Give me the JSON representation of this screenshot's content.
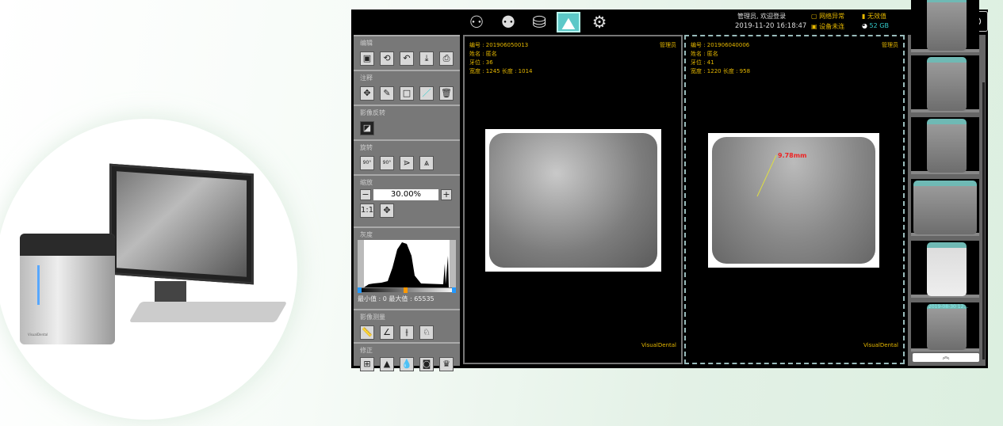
{
  "topbar": {
    "user": "管理员, 欢迎登录",
    "datetime": "2019-11-20 16:18:47",
    "network": "网络异常",
    "device": "设备未连",
    "value": "无效值",
    "disk": "52 GB"
  },
  "toolbar": {
    "nav_icons": [
      "add-patient-icon",
      "patients-icon",
      "database-search-icon",
      "image-icon",
      "settings-icon"
    ],
    "right_icons": [
      "network-settings-icon",
      "export-icon",
      "power-icon"
    ]
  },
  "left_panel": {
    "sections": [
      {
        "label": "编辑"
      },
      {
        "label": "注释"
      },
      {
        "label": "影像反转"
      },
      {
        "label": "旋转"
      },
      {
        "label": "缩放"
      },
      {
        "label": "灰度"
      },
      {
        "label": "影像测量"
      },
      {
        "label": "修正"
      }
    ],
    "zoom_value": "30.00%",
    "ratio_label": "1:1",
    "min_label": "最小值 : 0",
    "max_label": "最大值 : 65535",
    "rotate_left": "90°",
    "rotate_right": "90°"
  },
  "viewers": [
    {
      "id_line": "编号 : 201906050013",
      "name_line": "姓名 : 匿名",
      "tooth_line": "牙位 : 36",
      "size_line": "宽度 : 1245  长度 : 1014",
      "role": "管理员",
      "brand": "VisualDental"
    },
    {
      "id_line": "编号 : 201906040006",
      "name_line": "姓名 : 匿名",
      "tooth_line": "牙位 : 41",
      "size_line": "宽度 : 1220  长度 : 958",
      "role": "管理员",
      "brand": "VisualDental",
      "measurement": "9.78mm"
    }
  ],
  "thumbnails": {
    "date": "2019-08-30 12..."
  },
  "product": {
    "device_label": "VisualDental"
  }
}
